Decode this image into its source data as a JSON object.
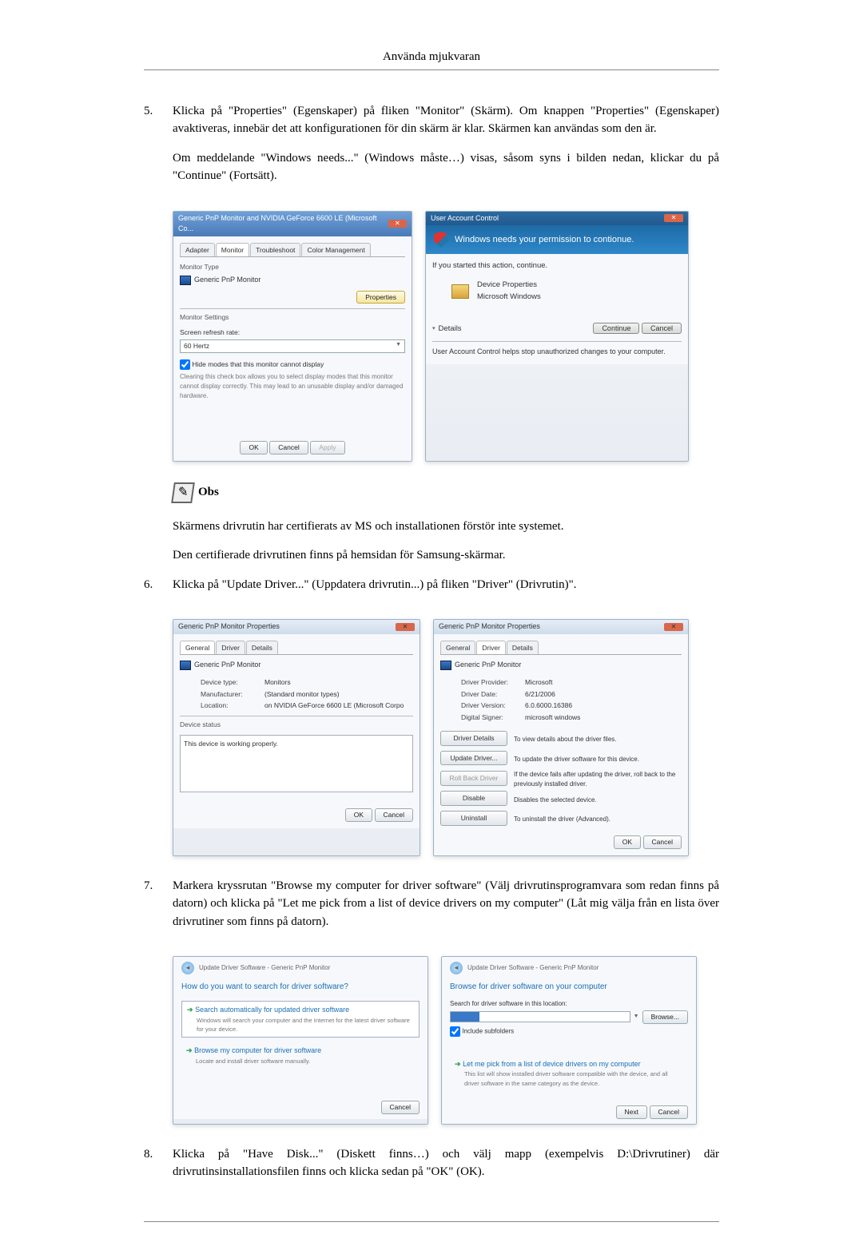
{
  "header": {
    "title": "Använda mjukvaran"
  },
  "step5": {
    "num": "5.",
    "p1": "Klicka på \"Properties\" (Egenskaper) på fliken \"Monitor\" (Skärm). Om knappen \"Properties\" (Egenskaper) avaktiveras, innebär det att konfigurationen för din skärm är klar. Skärmen kan användas som den är.",
    "p2": "Om meddelande \"Windows needs...\" (Windows måste…) visas, såsom syns i bilden nedan, klickar du på \"Continue\" (Fortsätt)."
  },
  "fig_monitor": {
    "title": "Generic PnP Monitor and NVIDIA GeForce 6600 LE (Microsoft Co...",
    "tabs": [
      "Adapter",
      "Monitor",
      "Troubleshoot",
      "Color Management"
    ],
    "monitor_type_label": "Monitor Type",
    "monitor_name": "Generic PnP Monitor",
    "properties_btn": "Properties",
    "settings_label": "Monitor Settings",
    "refresh_label": "Screen refresh rate:",
    "refresh_value": "60 Hertz",
    "hide_modes": "Hide modes that this monitor cannot display",
    "hide_desc": "Clearing this check box allows you to select display modes that this monitor cannot display correctly. This may lead to an unusable display and/or damaged hardware.",
    "ok": "OK",
    "cancel": "Cancel",
    "apply": "Apply"
  },
  "fig_uac": {
    "title": "User Account Control",
    "bar": "Windows needs your permission to contionue.",
    "line1": "If you started this action, continue.",
    "prog": "Device Properties",
    "pub": "Microsoft Windows",
    "details": "Details",
    "continue": "Continue",
    "cancel": "Cancel",
    "footer": "User Account Control helps stop unauthorized changes to your computer."
  },
  "note": {
    "label": "Obs",
    "line1": "Skärmens drivrutin har certifierats av MS och installationen förstör inte systemet.",
    "line2": "Den certifierade drivrutinen finns på hemsidan för Samsung-skärmar."
  },
  "step6": {
    "num": "6.",
    "text": "Klicka på \"Update Driver...\" (Uppdatera drivrutin...) på fliken \"Driver\" (Drivrutin)\"."
  },
  "fig_general": {
    "title": "Generic PnP Monitor Properties",
    "tabs": [
      "General",
      "Driver",
      "Details"
    ],
    "monitor_name": "Generic PnP Monitor",
    "device_type_l": "Device type:",
    "device_type_v": "Monitors",
    "manufacturer_l": "Manufacturer:",
    "manufacturer_v": "(Standard monitor types)",
    "location_l": "Location:",
    "location_v": "on NVIDIA GeForce 6600 LE (Microsoft Corpo",
    "status_label": "Device status",
    "status_text": "This device is working properly.",
    "ok": "OK",
    "cancel": "Cancel"
  },
  "fig_driver": {
    "title": "Generic PnP Monitor Properties",
    "tabs": [
      "General",
      "Driver",
      "Details"
    ],
    "monitor_name": "Generic PnP Monitor",
    "provider_l": "Driver Provider:",
    "provider_v": "Microsoft",
    "date_l": "Driver Date:",
    "date_v": "6/21/2006",
    "version_l": "Driver Version:",
    "version_v": "6.0.6000.16386",
    "signer_l": "Digital Signer:",
    "signer_v": "microsoft windows",
    "btn_details": "Driver Details",
    "btn_details_d": "To view details about the driver files.",
    "btn_update": "Update Driver...",
    "btn_update_d": "To update the driver software for this device.",
    "btn_rollback": "Roll Back Driver",
    "btn_rollback_d": "If the device fails after updating the driver, roll back to the previously installed driver.",
    "btn_disable": "Disable",
    "btn_disable_d": "Disables the selected device.",
    "btn_uninstall": "Uninstall",
    "btn_uninstall_d": "To uninstall the driver (Advanced).",
    "ok": "OK",
    "cancel": "Cancel"
  },
  "step7": {
    "num": "7.",
    "text": "Markera kryssrutan \"Browse my computer for driver software\" (Välj drivrutinsprogramvara som redan finns på datorn) och klicka på \"Let me pick from a list of device drivers on my computer\" (Låt mig välja från en lista över drivrutiner som finns på datorn)."
  },
  "fig_update1": {
    "crumb": "Update Driver Software - Generic PnP Monitor",
    "heading": "How do you want to search for driver software?",
    "opt1_title": "Search automatically for updated driver software",
    "opt1_desc": "Windows will search your computer and the Internet for the latest driver software for your device.",
    "opt2_title": "Browse my computer for driver software",
    "opt2_desc": "Locate and install driver software manually.",
    "cancel": "Cancel"
  },
  "fig_update2": {
    "crumb": "Update Driver Software - Generic PnP Monitor",
    "heading": "Browse for driver software on your computer",
    "search_label": "Search for driver software in this location:",
    "browse": "Browse...",
    "include": "Include subfolders",
    "opt_title": "Let me pick from a list of device drivers on my computer",
    "opt_desc": "This list will show installed driver software compatible with the device, and all driver software in the same category as the device.",
    "next": "Next",
    "cancel": "Cancel"
  },
  "step8": {
    "num": "8.",
    "text": "Klicka på \"Have Disk...\" (Diskett finns…) och välj mapp (exempelvis D:\\Drivrutiner) där drivrutinsinstallationsfilen finns och klicka sedan på \"OK\" (OK)."
  }
}
